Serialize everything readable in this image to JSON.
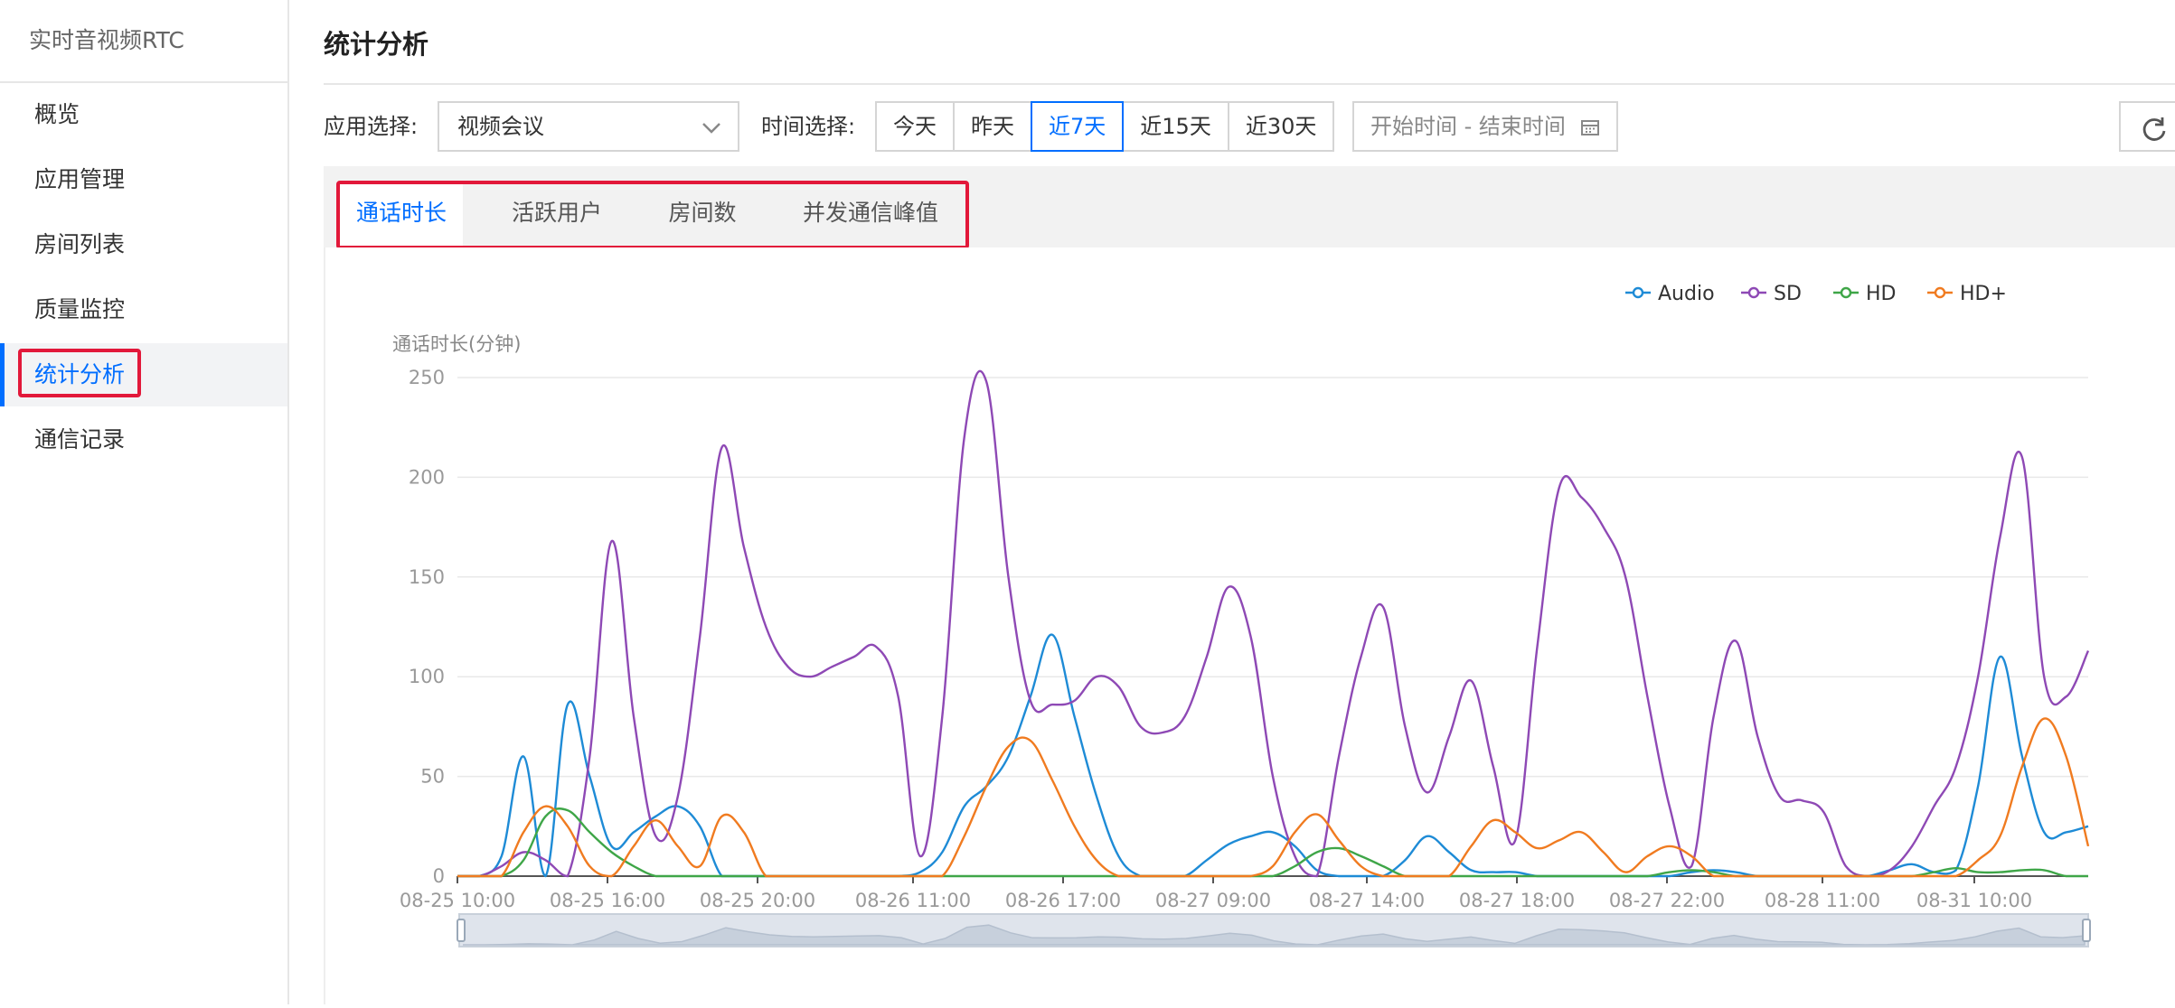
{
  "sidebar": {
    "title": "实时音视频RTC",
    "items": [
      {
        "label": "概览"
      },
      {
        "label": "应用管理"
      },
      {
        "label": "房间列表"
      },
      {
        "label": "质量监控"
      },
      {
        "label": "统计分析"
      },
      {
        "label": "通信记录"
      }
    ],
    "active_index": 4
  },
  "header": {
    "title": "统计分析"
  },
  "filters": {
    "app_label": "应用选择:",
    "app_value": "视频会议",
    "time_label": "时间选择:",
    "time_options": [
      "今天",
      "昨天",
      "近7天",
      "近15天",
      "近30天"
    ],
    "time_active_index": 2,
    "date_range_placeholder": "开始时间 - 结束时间"
  },
  "icons": {
    "app_select": "chevron-down-icon",
    "date_range": "calendar-icon",
    "refresh": "refresh-icon"
  },
  "tabs": [
    {
      "label": "通话时长"
    },
    {
      "label": "活跃用户"
    },
    {
      "label": "房间数"
    },
    {
      "label": "并发通信峰值"
    }
  ],
  "tabs_active_index": 0,
  "colors": {
    "accent": "#006eff",
    "highlight_box": "#e2183a",
    "Audio": "#1e8bd6",
    "SD": "#8e49b5",
    "HD": "#3fa648",
    "HD+": "#f07b20"
  },
  "chart_data": {
    "type": "line",
    "ylabel": "通话时长(分钟)",
    "ylim": [
      0,
      250
    ],
    "yticks": [
      0,
      50,
      100,
      150,
      200,
      250
    ],
    "x_tick_labels": [
      "08-25 10:00",
      "08-25 16:00",
      "08-25 20:00",
      "08-26 11:00",
      "08-26 17:00",
      "08-27 09:00",
      "08-27 14:00",
      "08-27 18:00",
      "08-27 22:00",
      "08-28 11:00",
      "08-31 10:00"
    ],
    "legend": [
      "Audio",
      "SD",
      "HD",
      "HD+"
    ],
    "legend_position": "top-right",
    "grid": true,
    "point_count": 56,
    "series": [
      {
        "name": "Audio",
        "points": [
          [
            0,
            0
          ],
          [
            1,
            0
          ],
          [
            2,
            10
          ],
          [
            3,
            60
          ],
          [
            5,
            86
          ],
          [
            6,
            50
          ],
          [
            7,
            15
          ],
          [
            8,
            22
          ],
          [
            9,
            30
          ],
          [
            10,
            35
          ],
          [
            11,
            25
          ],
          [
            12,
            0
          ],
          [
            20,
            0
          ],
          [
            21,
            2
          ],
          [
            22,
            12
          ],
          [
            23,
            35
          ],
          [
            24,
            45
          ],
          [
            25,
            60
          ],
          [
            26,
            90
          ],
          [
            27,
            121
          ],
          [
            28,
            80
          ],
          [
            29,
            40
          ],
          [
            30,
            10
          ],
          [
            31,
            0
          ],
          [
            33,
            0
          ],
          [
            34,
            8
          ],
          [
            35,
            16
          ],
          [
            36,
            20
          ],
          [
            37,
            22
          ],
          [
            38,
            15
          ],
          [
            39,
            3
          ],
          [
            40,
            0
          ],
          [
            42,
            0
          ],
          [
            43,
            8
          ],
          [
            44,
            20
          ],
          [
            45,
            12
          ],
          [
            46,
            3
          ],
          [
            47,
            2
          ],
          [
            48,
            2
          ],
          [
            49,
            0
          ],
          [
            55,
            0
          ],
          [
            56,
            2
          ],
          [
            57,
            3
          ],
          [
            58,
            2
          ],
          [
            59,
            0
          ],
          [
            64,
            0
          ],
          [
            65,
            3
          ],
          [
            66,
            6
          ],
          [
            67,
            2
          ],
          [
            68,
            3
          ],
          [
            69,
            45
          ],
          [
            70,
            110
          ],
          [
            71,
            60
          ],
          [
            72,
            22
          ],
          [
            73,
            22
          ],
          [
            74,
            25
          ]
        ]
      },
      {
        "name": "SD",
        "points": [
          [
            0,
            0
          ],
          [
            1,
            0
          ],
          [
            2,
            5
          ],
          [
            3,
            12
          ],
          [
            4,
            8
          ],
          [
            5,
            0
          ],
          [
            6,
            60
          ],
          [
            7,
            168
          ],
          [
            8,
            80
          ],
          [
            9,
            20
          ],
          [
            10,
            40
          ],
          [
            11,
            120
          ],
          [
            12,
            215
          ],
          [
            13,
            165
          ],
          [
            14,
            125
          ],
          [
            15,
            105
          ],
          [
            16,
            100
          ],
          [
            17,
            105
          ],
          [
            18,
            110
          ],
          [
            19,
            115
          ],
          [
            20,
            90
          ],
          [
            21,
            10
          ],
          [
            22,
            80
          ],
          [
            23,
            220
          ],
          [
            24,
            248
          ],
          [
            25,
            150
          ],
          [
            26,
            88
          ],
          [
            27,
            86
          ],
          [
            28,
            88
          ],
          [
            29,
            100
          ],
          [
            30,
            95
          ],
          [
            31,
            75
          ],
          [
            32,
            72
          ],
          [
            33,
            80
          ],
          [
            34,
            110
          ],
          [
            35,
            145
          ],
          [
            36,
            120
          ],
          [
            37,
            50
          ],
          [
            38,
            10
          ],
          [
            39,
            0
          ],
          [
            40,
            60
          ],
          [
            41,
            110
          ],
          [
            42,
            135
          ],
          [
            43,
            75
          ],
          [
            44,
            42
          ],
          [
            45,
            70
          ],
          [
            46,
            98
          ],
          [
            47,
            55
          ],
          [
            48,
            18
          ],
          [
            49,
            115
          ],
          [
            50,
            195
          ],
          [
            51,
            190
          ],
          [
            52,
            175
          ],
          [
            53,
            150
          ],
          [
            54,
            90
          ],
          [
            55,
            35
          ],
          [
            56,
            5
          ],
          [
            57,
            80
          ],
          [
            58,
            118
          ],
          [
            59,
            70
          ],
          [
            60,
            40
          ],
          [
            61,
            38
          ],
          [
            62,
            32
          ],
          [
            63,
            5
          ],
          [
            64,
            0
          ],
          [
            65,
            3
          ],
          [
            66,
            15
          ],
          [
            67,
            35
          ],
          [
            68,
            55
          ],
          [
            69,
            100
          ],
          [
            70,
            170
          ],
          [
            71,
            210
          ],
          [
            72,
            100
          ],
          [
            73,
            90
          ],
          [
            74,
            113
          ]
        ]
      },
      {
        "name": "HD",
        "points": [
          [
            0,
            0
          ],
          [
            2,
            0
          ],
          [
            3,
            8
          ],
          [
            4,
            30
          ],
          [
            5,
            33
          ],
          [
            6,
            22
          ],
          [
            7,
            12
          ],
          [
            8,
            5
          ],
          [
            9,
            0
          ],
          [
            37,
            0
          ],
          [
            38,
            5
          ],
          [
            39,
            12
          ],
          [
            40,
            14
          ],
          [
            41,
            10
          ],
          [
            42,
            5
          ],
          [
            43,
            0
          ],
          [
            54,
            0
          ],
          [
            55,
            2
          ],
          [
            56,
            3
          ],
          [
            57,
            2
          ],
          [
            58,
            0
          ],
          [
            66,
            0
          ],
          [
            67,
            2
          ],
          [
            68,
            4
          ],
          [
            69,
            2
          ],
          [
            70,
            2
          ],
          [
            71,
            3
          ],
          [
            72,
            3
          ],
          [
            73,
            0
          ],
          [
            74,
            0
          ]
        ]
      },
      {
        "name": "HD+",
        "points": [
          [
            0,
            0
          ],
          [
            2,
            0
          ],
          [
            3,
            22
          ],
          [
            4,
            35
          ],
          [
            5,
            25
          ],
          [
            6,
            5
          ],
          [
            7,
            0
          ],
          [
            8,
            15
          ],
          [
            9,
            28
          ],
          [
            10,
            15
          ],
          [
            11,
            5
          ],
          [
            12,
            30
          ],
          [
            13,
            22
          ],
          [
            14,
            0
          ],
          [
            22,
            0
          ],
          [
            23,
            20
          ],
          [
            24,
            45
          ],
          [
            25,
            65
          ],
          [
            26,
            68
          ],
          [
            27,
            48
          ],
          [
            28,
            25
          ],
          [
            29,
            8
          ],
          [
            30,
            0
          ],
          [
            36,
            0
          ],
          [
            37,
            5
          ],
          [
            38,
            22
          ],
          [
            39,
            31
          ],
          [
            40,
            18
          ],
          [
            41,
            5
          ],
          [
            42,
            0
          ],
          [
            45,
            0
          ],
          [
            46,
            15
          ],
          [
            47,
            28
          ],
          [
            48,
            22
          ],
          [
            49,
            14
          ],
          [
            50,
            18
          ],
          [
            51,
            22
          ],
          [
            52,
            12
          ],
          [
            53,
            2
          ],
          [
            54,
            10
          ],
          [
            55,
            15
          ],
          [
            56,
            10
          ],
          [
            57,
            0
          ],
          [
            68,
            0
          ],
          [
            69,
            8
          ],
          [
            70,
            20
          ],
          [
            71,
            55
          ],
          [
            72,
            79
          ],
          [
            73,
            60
          ],
          [
            74,
            15
          ]
        ]
      }
    ]
  }
}
